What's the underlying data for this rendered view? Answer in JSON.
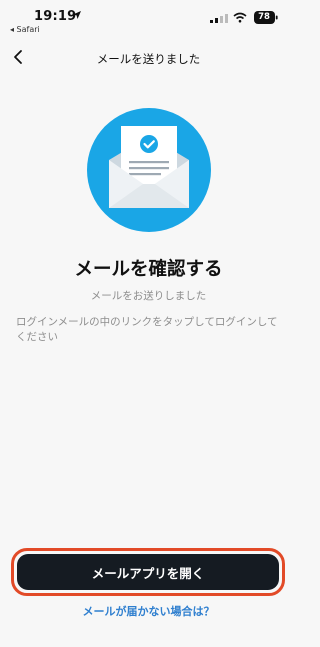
{
  "status": {
    "time": "19:19",
    "back_app": "◂ Safari",
    "battery": "78"
  },
  "nav": {
    "title": "メールを送りました"
  },
  "content": {
    "title": "メールを確認する",
    "subtitle": "メールをお送りしました",
    "description": "ログインメールの中のリンクをタップしてログインしてください"
  },
  "actions": {
    "open_mail": "メールアプリを開く",
    "not_received": "メールが届かない場合は？"
  },
  "colors": {
    "accent_blue": "#1aa6e6",
    "button_dark": "#151b22",
    "highlight_border": "#e24a27",
    "link_blue": "#2f7fcf"
  },
  "icons": {
    "back": "chevron-left-icon",
    "illustration": "email-checked-icon"
  }
}
